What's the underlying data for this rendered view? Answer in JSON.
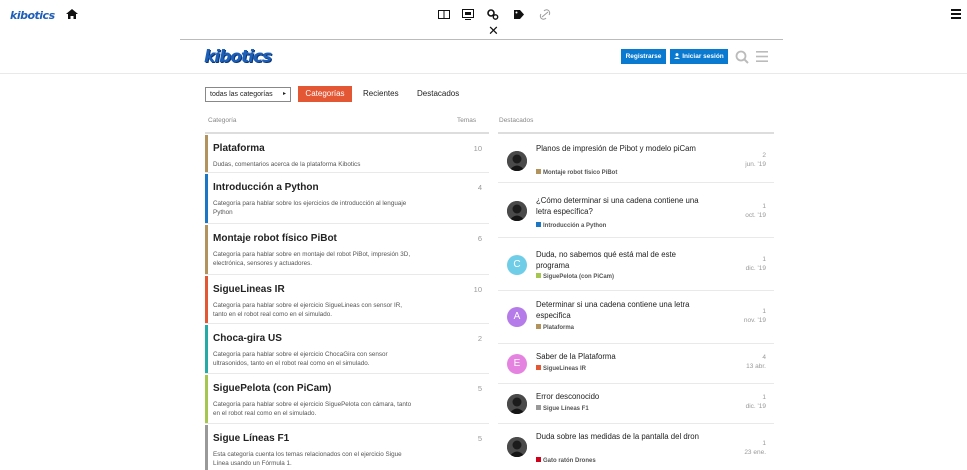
{
  "site_bar": {
    "logo_text": "kibotics",
    "icons": [
      "home-icon",
      "book-icon",
      "monitor-icon",
      "gears-icon",
      "tag-icon",
      "link-icon",
      "hamburger-menu-icon"
    ],
    "close_symbol": "✕"
  },
  "header": {
    "logo_text": "kibotics",
    "register_label": "Registrarse",
    "login_label": "Iniciar sesión"
  },
  "nav": {
    "category_dropdown": "todas las categorías",
    "dropdown_caret": "▸",
    "tabs": [
      {
        "label": "Categorías",
        "active": true
      },
      {
        "label": "Recientes",
        "active": false
      },
      {
        "label": "Destacados",
        "active": false
      }
    ]
  },
  "categories_header": {
    "category": "Categoría",
    "topics": "Temas"
  },
  "featured_header": "Destacados",
  "categories": [
    {
      "name": "Plataforma",
      "description": "Dudas, comentarios acerca de la plataforma Kibotics",
      "count": "10",
      "color": "#b3935d"
    },
    {
      "name": "Introducción a Python",
      "description": "Categoría para hablar sobre los ejercicios de introducción al lenguaje Python",
      "count": "4",
      "color": "#1b77c5"
    },
    {
      "name": "Montaje robot físico PiBot",
      "description": "Categoría para hablar sobre en montaje del robot PiBot, impresión 3D, electrónica, sensores y actuadores.",
      "count": "6",
      "color": "#b3935d"
    },
    {
      "name": "SigueLineas IR",
      "description": "Categoría para hablar sobre el ejercicio SigueLineas con sensor IR, tanto en el robot real como en el simulado.",
      "count": "10",
      "color": "#e45735"
    },
    {
      "name": "Choca-gira US",
      "description": "Categoría para hablar sobre el ejercicio ChocaGira con sensor ultrasonidos, tanto en el robot real como en el simulado.",
      "count": "2",
      "color": "#25aaa7"
    },
    {
      "name": "SiguePelota (con PiCam)",
      "description": "Categoría para hablar sobre el ejercicio SiguePelota con cámara, tanto en el robot real como en el simulado.",
      "count": "5",
      "color": "#a5c64f"
    },
    {
      "name": "Sigue Líneas F1",
      "description": "Esta categoría cuenta los temas relacionados con el ejercicio Sigue Línea usando un Fórmula 1.",
      "count": "5",
      "color": "#999999"
    }
  ],
  "featured": [
    {
      "title": "Planos de impresión de Pibot y modelo piCam",
      "category": "Montaje robot físico PiBot",
      "category_color": "#b3935d",
      "replies": "2",
      "date": "jun. '19",
      "avatar": "photo",
      "avatar_letter": "",
      "avatar_color": "#3a3a3a"
    },
    {
      "title": "¿Cómo determinar si una cadena contiene una letra específica?",
      "category": "Introducción a Python",
      "category_color": "#1b77c5",
      "replies": "1",
      "date": "oct. '19",
      "avatar": "photo",
      "avatar_letter": "",
      "avatar_color": "#3a3a3a"
    },
    {
      "title": "Duda, no sabemos qué está mal de este programa",
      "category": "SiguePelota (con PiCam)",
      "category_color": "#a5c64f",
      "replies": "1",
      "date": "dic. '19",
      "avatar": "letter",
      "avatar_letter": "C",
      "avatar_color": "#6fcde8"
    },
    {
      "title": "Determinar si una cadena contiene una letra especifica",
      "category": "Plataforma",
      "category_color": "#b3935d",
      "replies": "1",
      "date": "nov. '19",
      "avatar": "letter",
      "avatar_letter": "A",
      "avatar_color": "#b57be8"
    },
    {
      "title": "Saber de la Plataforma",
      "category": "SigueLineas IR",
      "category_color": "#e45735",
      "replies": "4",
      "date": "13 abr.",
      "avatar": "letter",
      "avatar_letter": "E",
      "avatar_color": "#e583e1"
    },
    {
      "title": "Error desconocido",
      "category": "Sigue Líneas F1",
      "category_color": "#999999",
      "replies": "1",
      "date": "dic. '19",
      "avatar": "photo",
      "avatar_letter": "",
      "avatar_color": "#3a3a3a"
    },
    {
      "title": "Duda sobre las medidas de la pantalla del dron",
      "category": "Gato ratón Drones",
      "category_color": "#d0021b",
      "replies": "1",
      "date": "23 ene.",
      "avatar": "photo",
      "avatar_letter": "",
      "avatar_color": "#3a3a3a"
    }
  ]
}
